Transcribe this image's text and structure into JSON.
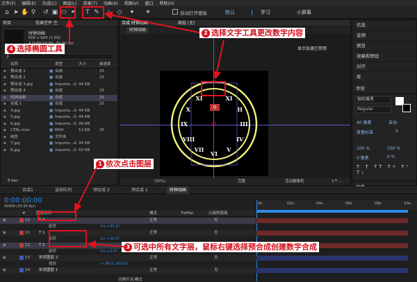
{
  "menu": [
    "文件(F)",
    "编辑(E)",
    "合成(C)",
    "图层(L)",
    "效果(T)",
    "动画(A)",
    "视图(V)",
    "窗口",
    "帮助(H)"
  ],
  "toolbar": {
    "auto_open": "自动打开面板",
    "ws_default": "默认",
    "ws_learn": "学习",
    "ws_small": "小屏幕"
  },
  "project": {
    "tab": "项目",
    "fx_tab": "效果控件 空",
    "comp_name": "时钟动画",
    "comp_size": "600 x 600 (1.00)",
    "comp_dur": "Δ 0:00:10:00, 25.00 fps",
    "search_placeholder": "ρ",
    "headers": {
      "name": "名称",
      "type": "类型",
      "size": "大小",
      "fps": "帧速率"
    },
    "rows": [
      {
        "name": "预合成 1",
        "type": "合成",
        "size": "",
        "fps": "25"
      },
      {
        "name": "预合成 2",
        "type": "合成",
        "size": "",
        "fps": "25"
      },
      {
        "name": "预合成 3.jpg",
        "type": "Importe...G",
        "size": "44 KB",
        "fps": ""
      },
      {
        "name": "预合成 4",
        "type": "合成",
        "size": "",
        "fps": "25"
      },
      {
        "name": "时钟动画",
        "type": "合成",
        "size": "",
        "fps": "25"
      },
      {
        "name": "合成 1",
        "type": "合成",
        "size": "",
        "fps": "25"
      },
      {
        "name": "4.jpg",
        "type": "Importe...G",
        "size": "44 KB",
        "fps": ""
      },
      {
        "name": "5.jpg",
        "type": "Importe...G",
        "size": "44 KB",
        "fps": ""
      },
      {
        "name": "6.jpg",
        "type": "Importe...G",
        "size": "36 KB",
        "fps": ""
      },
      {
        "name": "CTRL.mov",
        "type": "MOV",
        "size": "13 KB",
        "fps": "25"
      },
      {
        "name": "纯色",
        "type": "文件夹",
        "size": "",
        "fps": ""
      },
      {
        "name": "7.jpg",
        "type": "Importe...G",
        "size": "34 KB",
        "fps": ""
      },
      {
        "name": "8.jpg",
        "type": "Importe...G",
        "size": "50 KB",
        "fps": ""
      }
    ],
    "bpc": "8 bpc"
  },
  "comp": {
    "tab": "合成 时钟动画",
    "layer_tab": "图层 (无)",
    "sub_tab": "时钟动画",
    "notice": "显示加速已禁用",
    "zoom": "(50%)",
    "quality": "完整",
    "camera": "活动摄像机",
    "views": "1个…"
  },
  "clock": {
    "numbers": [
      "XI",
      "II",
      "III",
      "IV",
      "V",
      "VI",
      "VII",
      "VIII",
      "IX",
      "X",
      "XI",
      "XII"
    ],
    "top_num": "0"
  },
  "right": {
    "items": [
      "信息",
      "音频",
      "预览",
      "效果和预设",
      "对齐",
      "库"
    ],
    "char_title": "字符",
    "font": "微软雅黑",
    "style": "Regular",
    "size": "40 像素",
    "leading": "自动",
    "tracking": "度量标准",
    "kern": "0",
    "scale_v": "100 %",
    "scale_h": "100 %",
    "baseline": "0 像素",
    "tsume": "0 %",
    "para": "段落"
  },
  "timeline": {
    "tabs": [
      "合成1",
      "渲染队列",
      "预合成 2",
      "预合成 1",
      "时钟动画"
    ],
    "time": "0:00:00:00",
    "timesub": "00000 (25.00 fps)",
    "headers": {
      "num": "#",
      "name": "图层名称",
      "mode": "模式",
      "trkmat": "TrkMat",
      "parent": "父级和链接"
    },
    "ruler": [
      "0s",
      "02s",
      "04s",
      "06s",
      "08s",
      "10s"
    ],
    "rows": [
      {
        "num": "10",
        "name": "T  0",
        "mode": "正常",
        "parent": "无",
        "color": "#c23b3b",
        "sel": true
      },
      {
        "num": "",
        "name": "旋转",
        "mode": "",
        "parent": "",
        "color": "",
        "sub": "0x +45.0°"
      },
      {
        "num": "11",
        "name": "T  1",
        "mode": "正常",
        "parent": "无",
        "color": "#c23b3b"
      },
      {
        "num": "",
        "name": "旋转",
        "mode": "",
        "parent": "",
        "color": "",
        "sub": "0x +30.0°"
      },
      {
        "num": "12",
        "name": "T  2",
        "mode": "正常",
        "parent": "无",
        "color": "#c23b3b",
        "sel": true
      },
      {
        "num": "",
        "name": "旋转",
        "mode": "",
        "parent": "",
        "color": "",
        "sub": "0x +0.0°"
      },
      {
        "num": "13",
        "name": "形状图层 2",
        "mode": "正常",
        "parent": "无",
        "color": "#3b5bc2"
      },
      {
        "num": "",
        "name": "缩放",
        "mode": "",
        "parent": "",
        "color": "",
        "sub": "∞ 80.0, 80.0%"
      },
      {
        "num": "14",
        "name": "形状图层 1",
        "mode": "正常",
        "parent": "无",
        "color": "#3b5bc2"
      }
    ],
    "footer": "切换开关/模式"
  },
  "annotations": {
    "a1": "依次点击图层",
    "a2": "选择文字工具更改数字内容",
    "a3": "可选中所有文字层，鼠标右键选择预合成创建数字合成",
    "a4": "选择椭圆工具",
    "n1": "1",
    "n2": "2",
    "n3": "3",
    "n4": "4"
  },
  "colors": {
    "accent": "#2d8ceb",
    "annot_red": "#d3111d",
    "clock_yellow": "#f1f17a"
  }
}
